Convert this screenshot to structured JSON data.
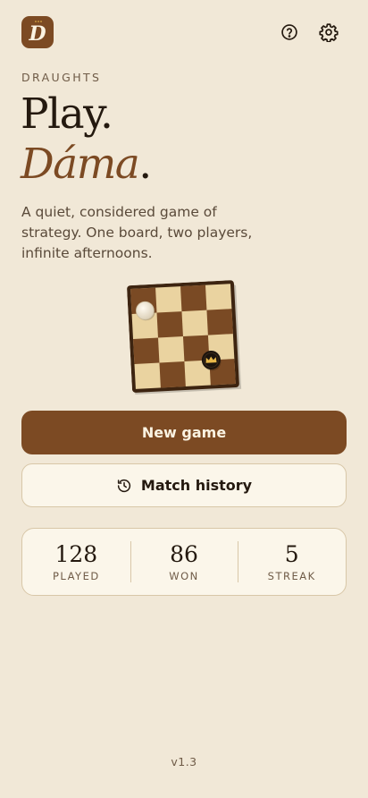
{
  "header": {
    "app_icon_letter": "D",
    "help_icon": "help-circle-icon",
    "settings_icon": "gear-icon"
  },
  "hero": {
    "eyebrow": "DRAUGHTS",
    "title_line1": "Play.",
    "title_line2": "Dáma",
    "title_line2_suffix": ".",
    "tagline": "A quiet, considered game of strategy. One board, two players, infinite afternoons."
  },
  "actions": {
    "new_game_label": "New game",
    "history_label": "Match history",
    "history_icon": "history-icon"
  },
  "stats": [
    {
      "value": "128",
      "label": "PLAYED"
    },
    {
      "value": "86",
      "label": "WON"
    },
    {
      "value": "5",
      "label": "STREAK"
    }
  ],
  "footer": {
    "version": "v1.3"
  },
  "colors": {
    "background": "#f1e8d7",
    "accent": "#7c4a23",
    "card": "#fbf6ea",
    "board_dark": "#7a4a24",
    "board_light": "#ead3a0"
  }
}
